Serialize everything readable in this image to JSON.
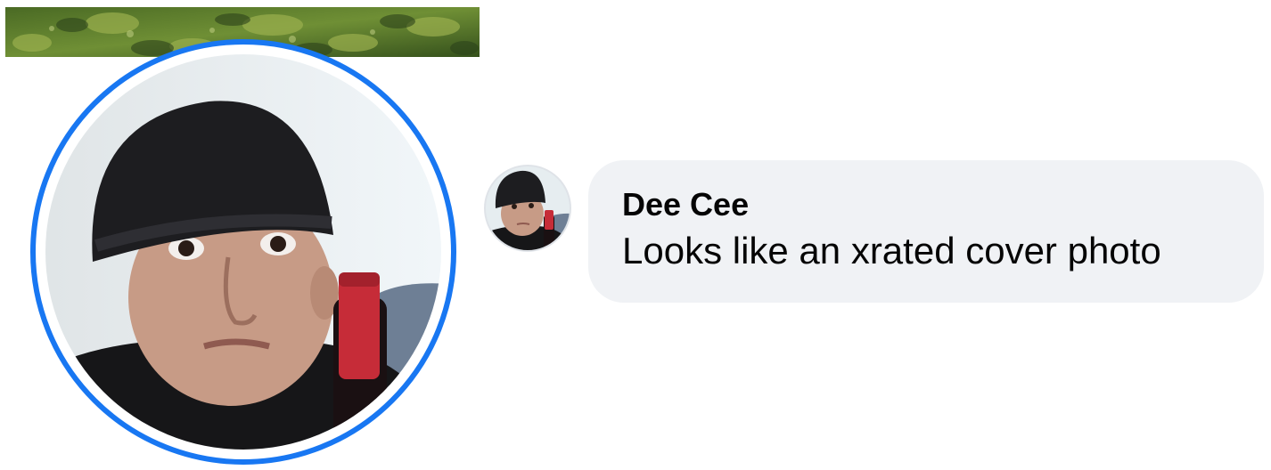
{
  "post": {
    "cover_photo": {
      "kind": "foliage",
      "colors": [
        "#3d5a1e",
        "#6f8f35",
        "#9bb04e",
        "#2c421a"
      ]
    },
    "profile_picture": {
      "ring_color": "#1877f2",
      "subject": "man-in-black-beanie-with-wine-bottle",
      "colors": {
        "beanie": "#1d1d20",
        "skin": "#c79b86",
        "bottle_capsule": "#c62c38",
        "wall": "#e8eef1",
        "couch": "#6e7f95"
      }
    }
  },
  "comment": {
    "author": "Dee Cee",
    "text": "Looks like an xrated cover photo",
    "bubble_color": "#f0f2f5",
    "avatar": {
      "subject": "man-in-black-beanie-with-wine-bottle"
    }
  }
}
